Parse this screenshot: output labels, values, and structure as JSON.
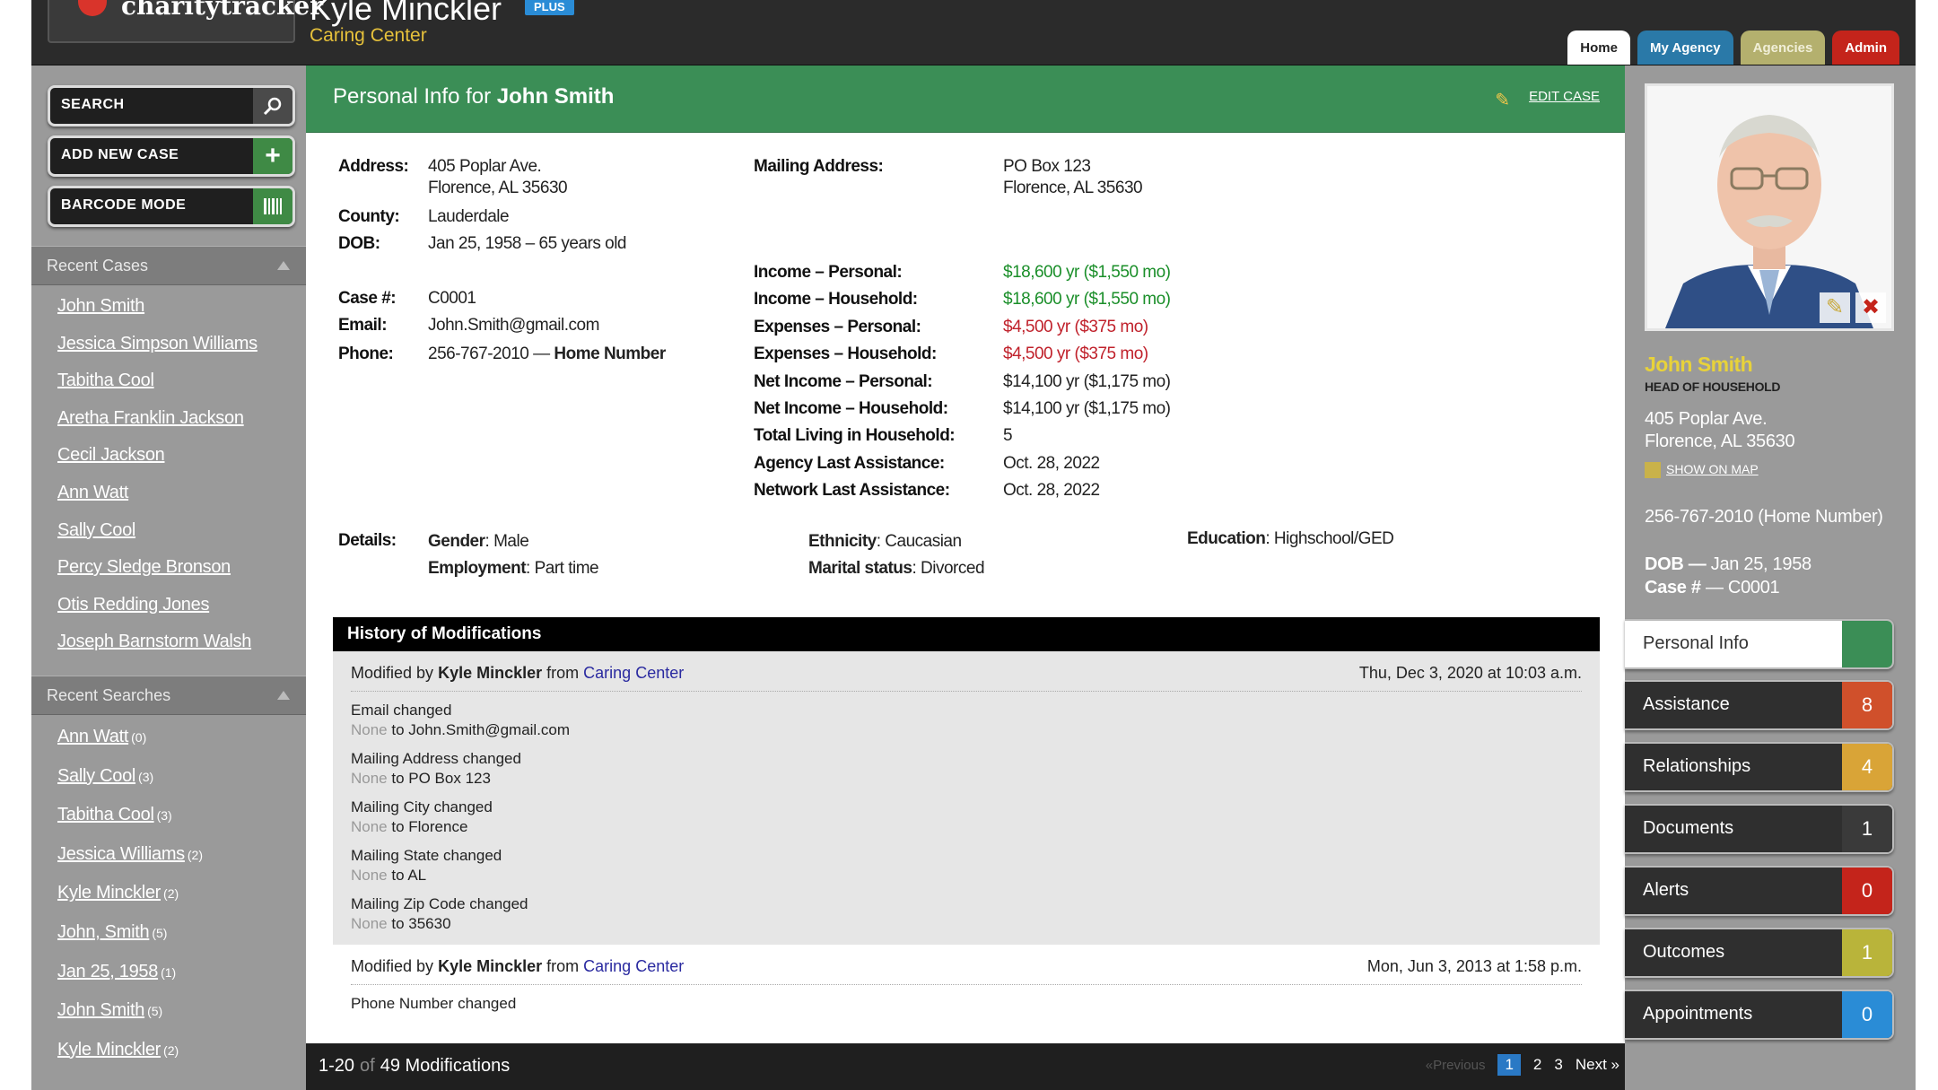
{
  "header": {
    "logo_text": "charitytracker",
    "user_name": "Kyle Minckler",
    "plus_badge": "PLUS",
    "agency": "Caring Center",
    "nav": [
      {
        "label": "Home",
        "color": "#ffffff"
      },
      {
        "label": "My Agency",
        "color": "#2a79a8"
      },
      {
        "label": "Agencies",
        "color": "#b4b06e"
      },
      {
        "label": "Admin",
        "color": "#c4241b"
      }
    ]
  },
  "sidebar": {
    "buttons": [
      {
        "label": "SEARCH",
        "icon": "search-icon"
      },
      {
        "label": "ADD NEW CASE",
        "icon": "plus-icon"
      },
      {
        "label": "BARCODE MODE",
        "icon": "barcode-icon"
      }
    ],
    "recent_cases_title": "Recent Cases",
    "recent_cases": [
      "John Smith",
      "Jessica Simpson Williams",
      "Tabitha Cool",
      "Aretha Franklin Jackson",
      "Cecil Jackson",
      "Ann Watt",
      "Sally Cool",
      "Percy Sledge Bronson",
      "Otis Redding Jones",
      "Joseph Barnstorm Walsh"
    ],
    "recent_searches_title": "Recent Searches",
    "recent_searches": [
      {
        "label": "Ann Watt",
        "count": "(0)"
      },
      {
        "label": "Sally Cool",
        "count": "(3)"
      },
      {
        "label": "Tabitha Cool",
        "count": "(3)"
      },
      {
        "label": "Jessica Williams",
        "count": "(2)"
      },
      {
        "label": "Kyle Minckler",
        "count": "(2)"
      },
      {
        "label": "John, Smith",
        "count": "(5)"
      },
      {
        "label": "Jan 25, 1958",
        "count": "(1)"
      },
      {
        "label": "John Smith",
        "count": "(5)"
      },
      {
        "label": "Kyle Minckler",
        "count": "(2)"
      }
    ]
  },
  "main": {
    "title_prefix": "Personal Info for",
    "title_name": "John Smith",
    "edit_case": "EDIT CASE",
    "address_label": "Address:",
    "address_line1": "405 Poplar Ave.",
    "address_line2": "Florence, AL 35630",
    "county_label": "County:",
    "county": "Lauderdale",
    "dob_label": "DOB:",
    "dob": "Jan 25, 1958 – 65 years old",
    "case_label": "Case #:",
    "case": "C0001",
    "email_label": "Email:",
    "email": "John.Smith@gmail.com",
    "phone_label": "Phone:",
    "phone": "256-767-2010 —",
    "phone_type": "Home Number",
    "mailing_label": "Mailing Address:",
    "mailing_line1": "PO Box 123",
    "mailing_line2": "Florence, AL 35630",
    "financials": [
      {
        "label": "Income – Personal:",
        "value": "$18,600 yr ($1,550 mo)",
        "tone": "green"
      },
      {
        "label": "Income – Household:",
        "value": "$18,600 yr ($1,550 mo)",
        "tone": "green"
      },
      {
        "label": "Expenses – Personal:",
        "value": "$4,500 yr ($375 mo)",
        "tone": "red"
      },
      {
        "label": "Expenses – Household:",
        "value": "$4,500 yr ($375 mo)",
        "tone": "red"
      },
      {
        "label": "Net Income – Personal:",
        "value": "$14,100 yr ($1,175 mo)",
        "tone": "plain"
      },
      {
        "label": "Net Income – Household:",
        "value": "$14,100 yr ($1,175 mo)",
        "tone": "plain"
      },
      {
        "label": "Total Living in Household:",
        "value": "5",
        "tone": "plain"
      },
      {
        "label": "Agency Last Assistance:",
        "value": "Oct. 28, 2022",
        "tone": "plain"
      },
      {
        "label": "Network Last Assistance:",
        "value": "Oct. 28, 2022",
        "tone": "plain"
      }
    ],
    "details_label": "Details:",
    "details": {
      "gender_label": "Gender",
      "gender": ": Male",
      "employment_label": "Employment",
      "employment": ": Part time",
      "ethnicity_label": "Ethnicity",
      "ethnicity": ": Caucasian",
      "marital_label": "Marital status",
      "marital": ": Divorced",
      "education_label": "Education",
      "education": ": Highschool/GED"
    },
    "history_title": "History of Modifications",
    "history": [
      {
        "by_prefix": "Modified by",
        "by": "Kyle Minckler",
        "from": "from",
        "agency": "Caring Center",
        "date": "Thu, Dec 3, 2020 at 10:03 a.m.",
        "changes": [
          {
            "title": "Email changed",
            "from": "None",
            "to": "to John.Smith@gmail.com"
          },
          {
            "title": "Mailing Address changed",
            "from": "None",
            "to": "to PO Box 123"
          },
          {
            "title": "Mailing City changed",
            "from": "None",
            "to": "to Florence"
          },
          {
            "title": "Mailing State changed",
            "from": "None",
            "to": "to AL"
          },
          {
            "title": "Mailing Zip Code changed",
            "from": "None",
            "to": "to 35630"
          }
        ]
      },
      {
        "by_prefix": "Modified by",
        "by": "Kyle Minckler",
        "from": "from",
        "agency": "Caring Center",
        "date": "Mon, Jun 3, 2013 at 1:58 p.m.",
        "changes": [
          {
            "title": "Phone Number changed",
            "from": "",
            "to": ""
          }
        ]
      }
    ],
    "pagination": {
      "range": "1-20",
      "of": "of",
      "total": "49 Modifications",
      "prev": "«Previous",
      "pages": [
        "1",
        "2",
        "3"
      ],
      "next": "Next »"
    }
  },
  "profile": {
    "name": "John Smith",
    "role": "HEAD OF HOUSEHOLD",
    "address_line1": "405 Poplar Ave.",
    "address_line2": "Florence, AL  35630",
    "show_on_map": "SHOW ON MAP",
    "phone": "256-767-2010 (Home Number)",
    "dob_label": "DOB —",
    "dob": "Jan 25, 1958",
    "case_label": "Case #",
    "case": "—  C0001",
    "tabs": [
      {
        "label": "Personal Info",
        "count": "",
        "color": "#3b8e56"
      },
      {
        "label": "Assistance",
        "count": "8",
        "color": "#d0502b"
      },
      {
        "label": "Relationships",
        "count": "4",
        "color": "#d9a437"
      },
      {
        "label": "Documents",
        "count": "1",
        "color": "#3a3a3a"
      },
      {
        "label": "Alerts",
        "count": "0",
        "color": "#c4241b"
      },
      {
        "label": "Outcomes",
        "count": "1",
        "color": "#b9b43a"
      },
      {
        "label": "Appointments",
        "count": "0",
        "color": "#2a8cd6"
      }
    ]
  }
}
